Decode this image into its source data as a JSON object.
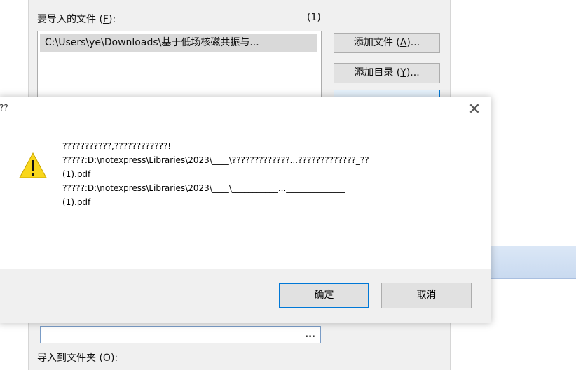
{
  "import_dialog": {
    "files_label": "要导入的文件 (F):",
    "files_label_pre": "要导入的文件 (",
    "files_label_key": "F",
    "files_label_post": "):",
    "file_count": "(1)",
    "file_list": [
      "C:\\Users\\ye\\Downloads\\基于低场核磁共振与..."
    ],
    "add_file_pre": "添加文件 (",
    "add_file_key": "A",
    "add_file_post": ")...",
    "add_dir_pre": "添加目录 (",
    "add_dir_key": "Y",
    "add_dir_post": ")...",
    "path_ellipsis": "...",
    "folder_label_pre": "导入到文件夹 (",
    "folder_label_key": "O",
    "folder_label_post": "):"
  },
  "message_box": {
    "title": "??",
    "close_glyph": "✕",
    "lines": [
      "???????????,????????????!",
      "?????:D:\\notexpress\\Libraries\\2023\\____\\?????????????...?????????????_??",
      "(1).pdf",
      "?????:D:\\notexpress\\Libraries\\2023\\____\\___________...______________",
      "(1).pdf"
    ],
    "ok_label": "确定",
    "cancel_label": "取消"
  },
  "colors": {
    "warning_yellow": "#f9d71c",
    "focus_blue": "#0078d7",
    "dialog_bg": "#f0f0f0"
  },
  "icons": {
    "warning": "warning-icon",
    "close": "close-icon"
  }
}
